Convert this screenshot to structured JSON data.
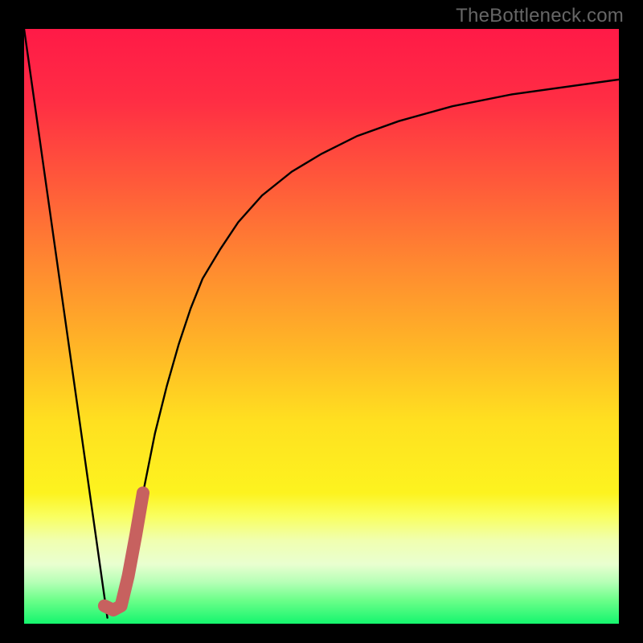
{
  "watermark": "TheBottleneck.com",
  "chart_data": {
    "type": "line",
    "title": "",
    "xlabel": "",
    "ylabel": "",
    "xlim": [
      0,
      100
    ],
    "ylim": [
      0,
      100
    ],
    "series": [
      {
        "name": "left-falling-line",
        "style": "thin-black",
        "x": [
          0,
          14
        ],
        "y": [
          100,
          1
        ]
      },
      {
        "name": "right-rising-curve",
        "style": "thin-black",
        "x": [
          16,
          18,
          20,
          22,
          24,
          26,
          28,
          30,
          33,
          36,
          40,
          45,
          50,
          56,
          63,
          72,
          82,
          100
        ],
        "y": [
          3,
          12,
          22,
          32,
          40,
          47,
          53,
          58,
          63,
          67.5,
          72,
          76,
          79,
          82,
          84.5,
          87,
          89,
          91.5
        ]
      },
      {
        "name": "highlight-j-stroke",
        "style": "thick-accent",
        "x": [
          13.5,
          15.0,
          16.3,
          17.5,
          18.8,
          20.0
        ],
        "y": [
          3.0,
          2.3,
          3.0,
          8.0,
          15.0,
          22.0
        ]
      }
    ]
  },
  "colors": {
    "curve": "#000000",
    "accent": "#c7615f",
    "gradient_top": "#ff1a47",
    "gradient_bottom": "#14f56e"
  }
}
